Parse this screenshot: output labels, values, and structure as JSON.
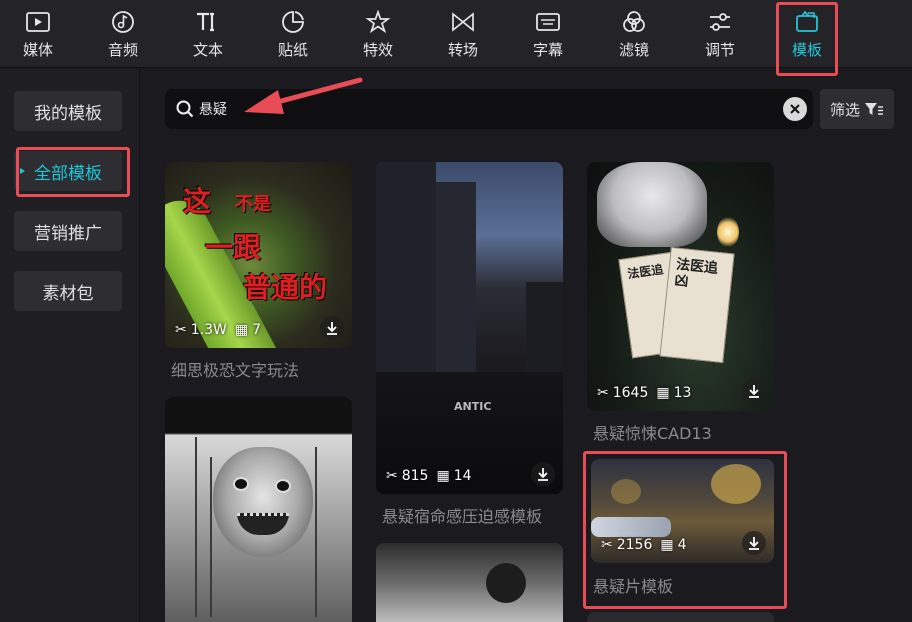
{
  "toolbar": {
    "items": [
      {
        "label": "媒体",
        "icon": "media-icon"
      },
      {
        "label": "音频",
        "icon": "audio-icon"
      },
      {
        "label": "文本",
        "icon": "text-icon"
      },
      {
        "label": "贴纸",
        "icon": "sticker-icon"
      },
      {
        "label": "特效",
        "icon": "effects-icon"
      },
      {
        "label": "转场",
        "icon": "transition-icon"
      },
      {
        "label": "字幕",
        "icon": "subtitle-icon"
      },
      {
        "label": "滤镜",
        "icon": "filter-icon"
      },
      {
        "label": "调节",
        "icon": "adjust-icon"
      },
      {
        "label": "模板",
        "icon": "template-icon",
        "active": true
      }
    ]
  },
  "sidebar": {
    "items": [
      {
        "label": "我的模板"
      },
      {
        "label": "全部模板",
        "active": true
      },
      {
        "label": "营销推广"
      },
      {
        "label": "素材包"
      }
    ]
  },
  "search": {
    "value": "悬疑",
    "filter_label": "筛选"
  },
  "cards": [
    {
      "title": "细思极恐文字玩法",
      "uses": "1.3W",
      "clips": "7",
      "overlay": {
        "w1": "这",
        "w2": "不是",
        "w3": "一跟",
        "w4": "普通的"
      }
    },
    {
      "title": "悬疑宿命感压迫感模板",
      "uses": "815",
      "clips": "14",
      "overlay": {
        "jacket": "ANTIC"
      }
    },
    {
      "title": "悬疑惊悚CAD13",
      "uses": "1645",
      "clips": "13",
      "overlay": {
        "book1": "法医追",
        "book2": "法医追凶"
      }
    },
    {
      "title": "悬疑片模板",
      "uses": "2156",
      "clips": "4"
    }
  ],
  "colors": {
    "accent": "#21c7d9",
    "highlight": "#e84d55",
    "background": "#1b1b1f"
  }
}
